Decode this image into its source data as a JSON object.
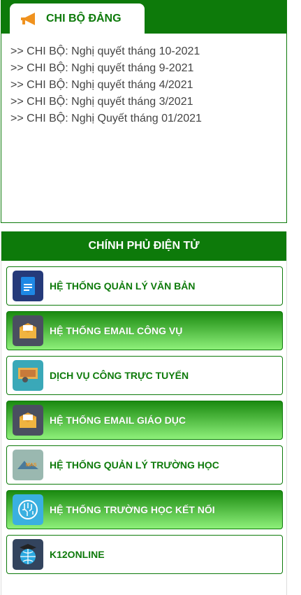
{
  "chi_bo": {
    "title": "CHI BỘ ĐẢNG",
    "items": [
      ">> CHI BỘ: Nghị quyết tháng 10-2021",
      ">> CHI BỘ: Nghị quyết tháng 9-2021",
      ">> CHI BỘ: Nghị quyết tháng 4/2021",
      ">> CHI BỘ: Nghị quyết tháng 3/2021",
      ">> CHI BỘ: Nghị Quyết tháng 01/2021"
    ]
  },
  "egov": {
    "title": "CHÍNH PHỦ ĐIỆN TỬ",
    "items": [
      {
        "label": "HỆ THỐNG QUẢN LÝ VĂN BẢN",
        "icon": "document-icon",
        "style": "white"
      },
      {
        "label": "HỆ THỐNG EMAIL CÔNG VỤ",
        "icon": "envelope-icon",
        "style": "green"
      },
      {
        "label": "DỊCH VỤ CÔNG TRỰC TUYẾN",
        "icon": "public-service-icon",
        "style": "white"
      },
      {
        "label": "HỆ THỐNG EMAIL GIÁO DỤC",
        "icon": "envelope-icon",
        "style": "green"
      },
      {
        "label": "HỆ THỐNG QUẢN LÝ TRƯỜNG HỌC",
        "icon": "mas-logo-icon",
        "style": "white"
      },
      {
        "label": "HỆ THỐNG TRƯỜNG HỌC KẾT NỐI",
        "icon": "circuit-icon",
        "style": "green"
      },
      {
        "label": "K12ONLINE",
        "icon": "globe-graduation-icon",
        "style": "white"
      }
    ]
  },
  "colors": {
    "brand_green": "#0d7a0a",
    "light_green": "#8ef07a",
    "icon_orange": "#f0921e"
  }
}
